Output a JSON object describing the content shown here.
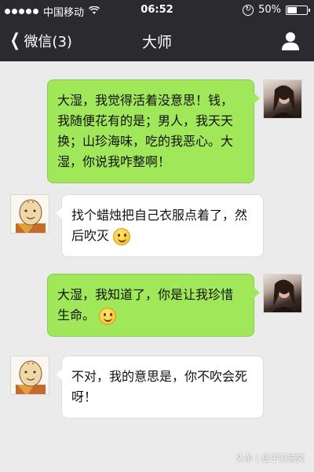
{
  "status_bar": {
    "carrier": "中国移动",
    "time": "06:52",
    "battery": "50%",
    "battery_level": 0.5
  },
  "nav": {
    "back_label": "微信(3)",
    "title": "大师"
  },
  "messages": [
    {
      "from": "me",
      "avatar": "woman-avatar",
      "text": "大湿，我觉得活着没意思！钱，我随便花有的是；男人，我天天换；山珍海味，吃的我恶心。大湿，你说我咋整啊！"
    },
    {
      "from": "master",
      "avatar": "monk-avatar",
      "text": "找个蜡烛把自己衣服点着了，然后吹灭",
      "emoji": "smile"
    },
    {
      "from": "me",
      "avatar": "woman-avatar",
      "text": "大湿，我知道了，你是让我珍惜生命。",
      "emoji": "smile"
    },
    {
      "from": "master",
      "avatar": "monk-avatar",
      "text": "不对，我的意思是，你不吹会死呀！"
    }
  ],
  "watermark": "头条 | 痘子爱搞笑",
  "colors": {
    "bar_background": "#2b2b2f",
    "chat_background": "#ebebeb",
    "my_bubble": "#a0e75a",
    "other_bubble": "#ffffff"
  }
}
